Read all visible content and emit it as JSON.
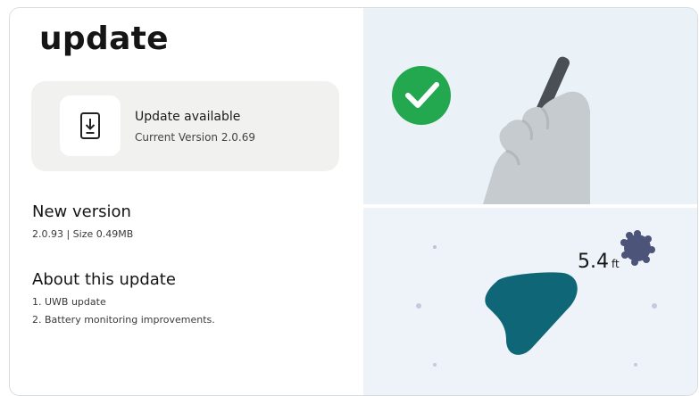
{
  "page": {
    "title": "update"
  },
  "update_card": {
    "icon": "download-phone-icon",
    "title": "Update available",
    "subtitle": "Current Version 2.0.69"
  },
  "new_version": {
    "heading": "New version",
    "details": "2.0.93 | Size 0.49MB"
  },
  "about": {
    "heading": "About this update",
    "items": [
      "1.  UWB update",
      "2. Battery monitoring improvements."
    ]
  },
  "illustration": {
    "top": {
      "badge_icon": "checkmark-icon",
      "image": "hand-holding-stylus"
    },
    "bottom": {
      "distance_value": "5.4",
      "distance_unit": "ft",
      "image": "direction-arrow"
    }
  },
  "colors": {
    "success": "#23a84f",
    "arrow": "#0f6677",
    "badge": "#4d547a",
    "hand": "#c6cbcf"
  }
}
